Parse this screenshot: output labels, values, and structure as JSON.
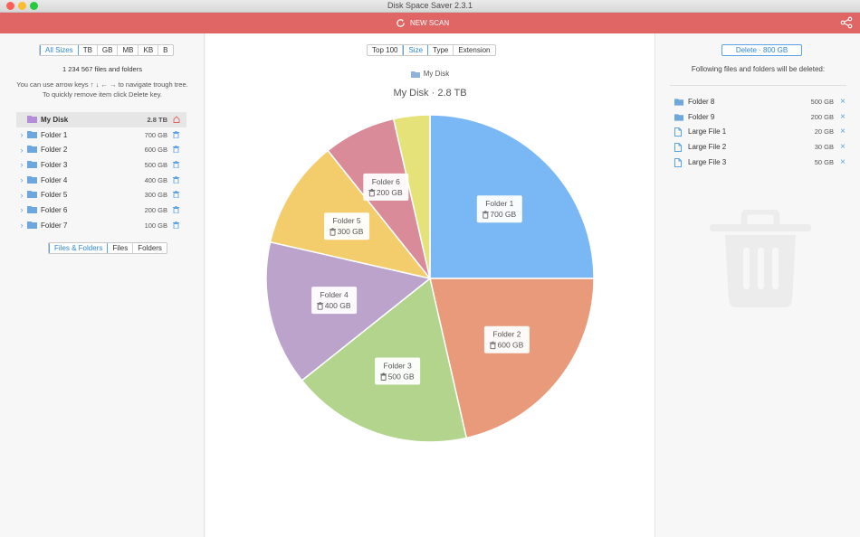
{
  "window": {
    "title": "Disk Space Saver 2.3.1"
  },
  "header": {
    "scan_label": "NEW SCAN",
    "color": "#e06666"
  },
  "left": {
    "size_filters": [
      "All Sizes",
      "TB",
      "GB",
      "MB",
      "KB",
      "B"
    ],
    "active_size_filter": "All Sizes",
    "count_text": "1 234 567 files and folders",
    "help_line1": "You can use arrow keys ↑ ↓ ← → to navigate trough tree.",
    "help_line2": "To quickly remove item click Delete key.",
    "root": {
      "name": "My Disk",
      "size": "2.8 TB"
    },
    "items": [
      {
        "name": "Folder 1",
        "size": "700 GB"
      },
      {
        "name": "Folder 2",
        "size": "600 GB"
      },
      {
        "name": "Folder 3",
        "size": "500 GB"
      },
      {
        "name": "Folder 4",
        "size": "400 GB"
      },
      {
        "name": "Folder 5",
        "size": "300 GB"
      },
      {
        "name": "Folder 6",
        "size": "200 GB"
      },
      {
        "name": "Folder 7",
        "size": "100 GB"
      }
    ],
    "view_filters": [
      "Files & Folders",
      "Files",
      "Folders"
    ],
    "active_view_filter": "Files & Folders"
  },
  "center": {
    "tabs": [
      "Top 100",
      "Size",
      "Type",
      "Extension"
    ],
    "active_tab": "Size",
    "breadcrumb": "My Disk",
    "chart_title": "My Disk · 2.8 TB"
  },
  "chart_data": {
    "type": "pie",
    "title": "My Disk · 2.8 TB",
    "slices": [
      {
        "label": "Folder 1",
        "value": 700,
        "display": "700 GB",
        "color": "#7ab8f5"
      },
      {
        "label": "Folder 2",
        "value": 600,
        "display": "600 GB",
        "color": "#e89a7a"
      },
      {
        "label": "Folder 3",
        "value": 500,
        "display": "500 GB",
        "color": "#b2d48c"
      },
      {
        "label": "Folder 4",
        "value": 400,
        "display": "400 GB",
        "color": "#bba3cb"
      },
      {
        "label": "Folder 5",
        "value": 300,
        "display": "300 GB",
        "color": "#f3cd6b"
      },
      {
        "label": "Folder 6",
        "value": 200,
        "display": "200 GB",
        "color": "#d98b9a"
      },
      {
        "label": "Folder 7",
        "value": 100,
        "display": "100 GB",
        "color": "#e6e27a"
      }
    ]
  },
  "right": {
    "delete_label": "Delete · 800 GB",
    "description": "Following files and folders will be deleted:",
    "items": [
      {
        "kind": "folder",
        "name": "Folder 8",
        "size": "500 GB"
      },
      {
        "kind": "folder",
        "name": "Folder 9",
        "size": "200 GB"
      },
      {
        "kind": "file",
        "name": "Large File 1",
        "size": "20 GB"
      },
      {
        "kind": "file",
        "name": "Large File 2",
        "size": "30 GB"
      },
      {
        "kind": "file",
        "name": "Large File 3",
        "size": "50 GB"
      }
    ],
    "remove_glyph": "×"
  }
}
